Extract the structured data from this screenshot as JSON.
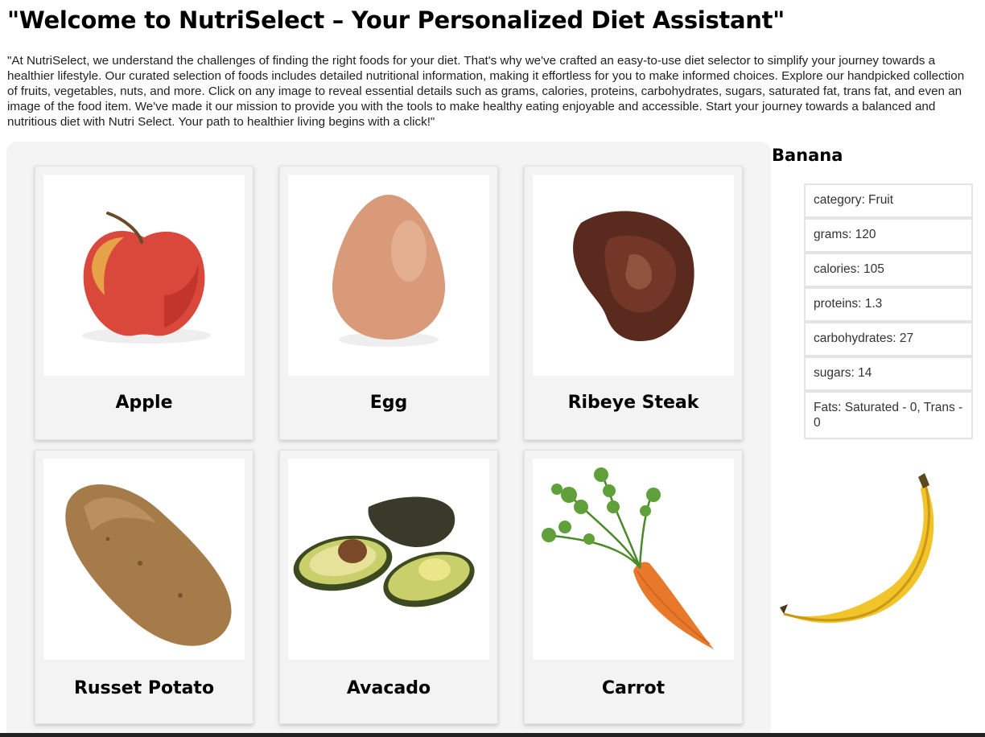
{
  "page": {
    "title": "\"Welcome to NutriSelect – Your Personalized Diet Assistant\"",
    "intro": "\"At NutriSelect, we understand the challenges of finding the right foods for your diet. That's why we've crafted an easy-to-use diet selector to simplify your journey towards a healthier lifestyle. Our curated selection of foods includes detailed nutritional information, making it effortless for you to make informed choices. Explore our handpicked collection of fruits, vegetables, nuts, and more. Click on any image to reveal essential details such as grams, calories, proteins, carbohydrates, sugars, saturated fat, trans fat, and even an image of the food item. We've made it our mission to provide you with the tools to make healthy eating enjoyable and accessible. Start your journey towards a balanced and nutritious diet with Nutri Select. Your path to healthier living begins with a click!\""
  },
  "foods": [
    {
      "name": "Apple",
      "icon": "apple-icon"
    },
    {
      "name": "Egg",
      "icon": "egg-icon"
    },
    {
      "name": "Ribeye Steak",
      "icon": "steak-icon"
    },
    {
      "name": "Russet Potato",
      "icon": "potato-icon"
    },
    {
      "name": "Avacado",
      "icon": "avocado-icon"
    },
    {
      "name": "Carrot",
      "icon": "carrot-icon"
    }
  ],
  "selected": {
    "name": "Banana",
    "icon": "banana-icon",
    "facts": [
      "category: Fruit",
      "grams: 120",
      "calories: 105",
      "proteins: 1.3",
      "carbohydrates: 27",
      "sugars: 14",
      "Fats: Saturated - 0, Trans - 0"
    ]
  },
  "colors": {
    "panel_bg": "#f4f4f4",
    "card_bg": "#f3f3f3",
    "fact_border": "#e4e4e4"
  }
}
